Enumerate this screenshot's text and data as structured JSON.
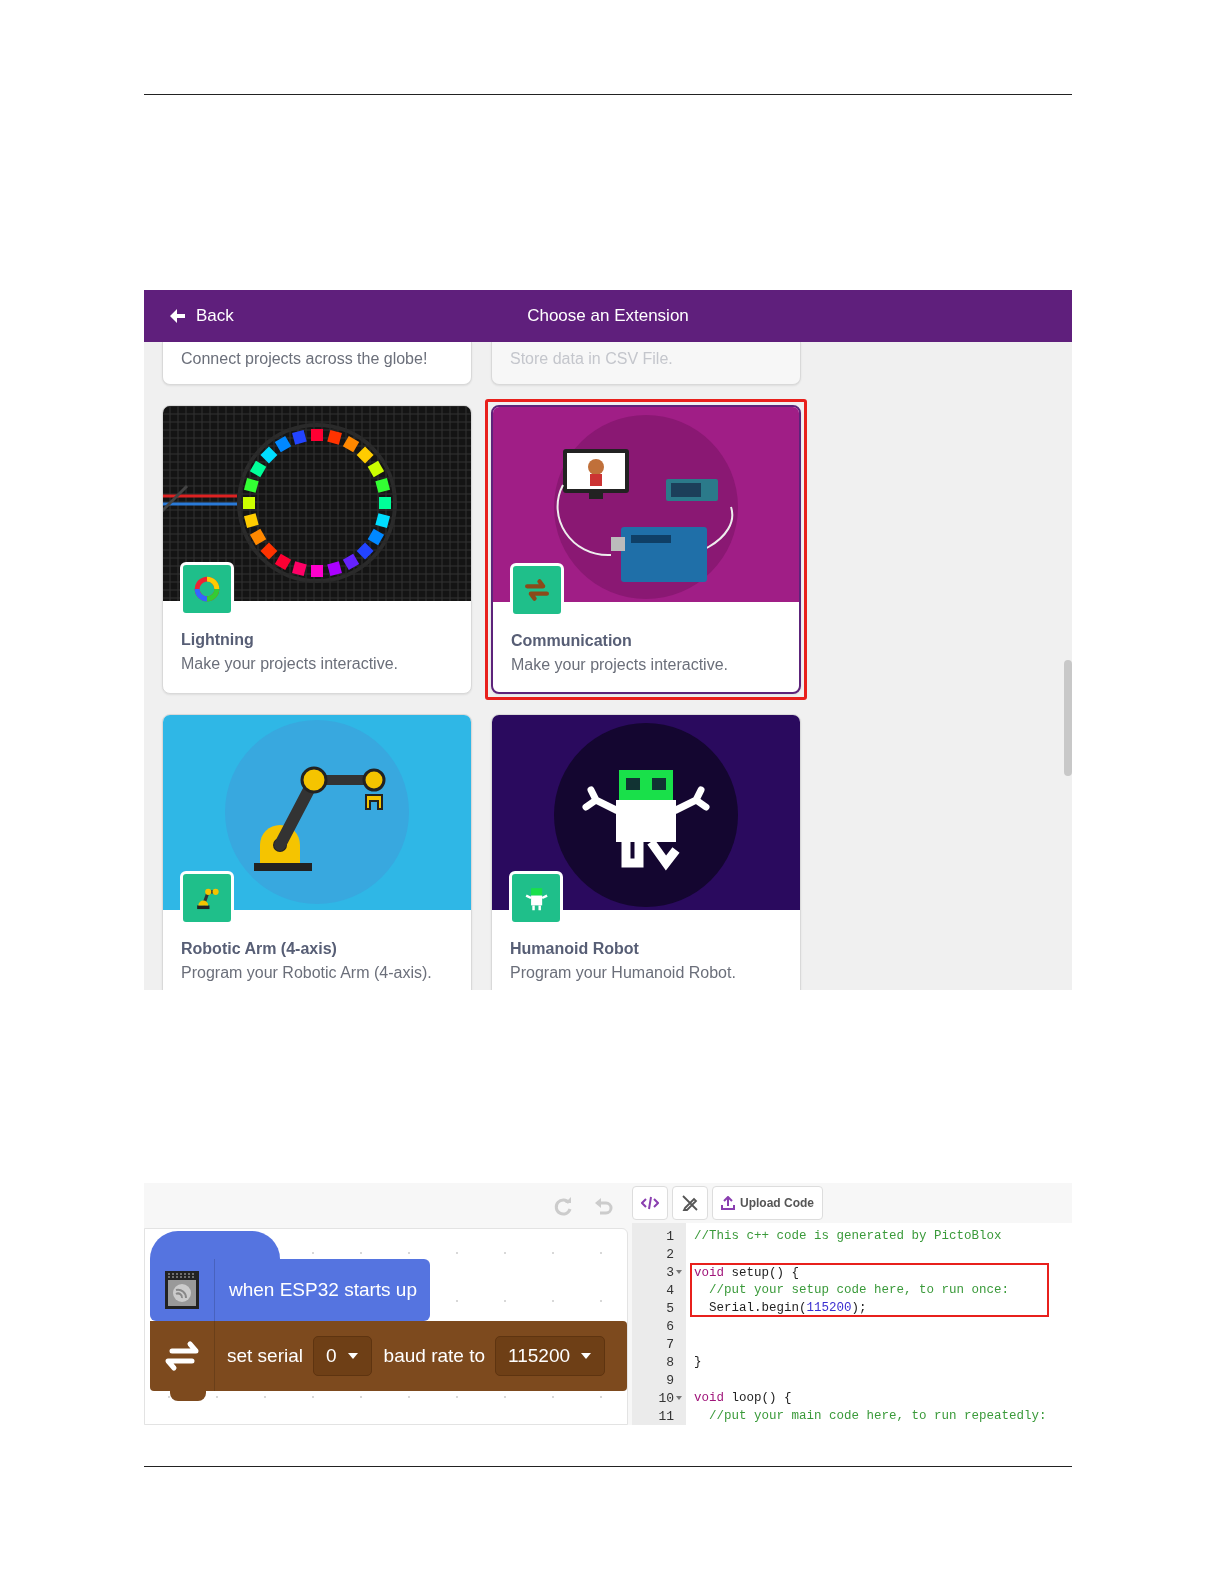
{
  "extension_dialog": {
    "back": "Back",
    "title": "Choose an Extension",
    "cards": [
      {
        "kind": "text",
        "description": "Connect projects across the globe!",
        "disabled": false,
        "selected": false
      },
      {
        "kind": "text",
        "description": "Store data in CSV File.",
        "disabled": true,
        "selected": false
      },
      {
        "kind": "lights",
        "title": "Lightning",
        "description": "Make your projects interactive.",
        "disabled": false,
        "selected": false
      },
      {
        "kind": "communication",
        "title": "Communication",
        "description": "Make your projects interactive.",
        "disabled": false,
        "selected": true
      },
      {
        "kind": "arm",
        "title": "Robotic Arm (4-axis)",
        "description": "Program your Robotic Arm (4-axis).",
        "disabled": false,
        "selected": false
      },
      {
        "kind": "robot",
        "title": "Humanoid Robot",
        "description": "Program your Humanoid Robot.",
        "disabled": false,
        "selected": false
      }
    ]
  },
  "code_workspace": {
    "upload_button": "Upload Code",
    "hat_block": {
      "text": "when ESP32 starts up"
    },
    "stack_block": {
      "parts": [
        {
          "kind": "label",
          "text": "set serial"
        },
        {
          "kind": "dropdown",
          "text": "0"
        },
        {
          "kind": "label",
          "text": "baud rate to"
        },
        {
          "kind": "dropdown",
          "text": "115200"
        }
      ]
    },
    "code_lines": [
      {
        "number": "1",
        "foldable": false,
        "highlighted": false,
        "tokens": [
          {
            "kind": "comment",
            "text": "//This c++ code is generated by PictoBlox"
          }
        ]
      },
      {
        "number": "2",
        "foldable": false
      },
      {
        "number": "3",
        "foldable": true,
        "highlighted": true,
        "tokens": [
          {
            "kind": "keyword",
            "text": "void"
          },
          {
            "kind": "plain",
            "text": " setup() {"
          }
        ]
      },
      {
        "number": "4",
        "foldable": false,
        "highlighted": true,
        "tokens": [
          {
            "kind": "comment",
            "text": "  //put your setup code here, to run once:"
          }
        ]
      },
      {
        "number": "5",
        "foldable": false,
        "highlighted": true,
        "tokens": [
          {
            "kind": "plain",
            "text": "  Serial.begin("
          },
          {
            "kind": "number",
            "text": "115200"
          },
          {
            "kind": "plain",
            "text": ");"
          }
        ]
      },
      {
        "number": "6",
        "foldable": false
      },
      {
        "number": "7",
        "foldable": false
      },
      {
        "number": "8",
        "foldable": false,
        "highlighted": false,
        "tokens": [
          {
            "kind": "plain",
            "text": "}"
          }
        ]
      },
      {
        "number": "9",
        "foldable": false
      },
      {
        "number": "10",
        "foldable": true,
        "highlighted": false,
        "tokens": [
          {
            "kind": "keyword",
            "text": "void"
          },
          {
            "kind": "plain",
            "text": " loop() {"
          }
        ]
      },
      {
        "number": "11",
        "foldable": false,
        "highlighted": false,
        "tokens": [
          {
            "kind": "comment",
            "text": "  //put your main code here, to run repeatedly:"
          }
        ]
      }
    ]
  }
}
